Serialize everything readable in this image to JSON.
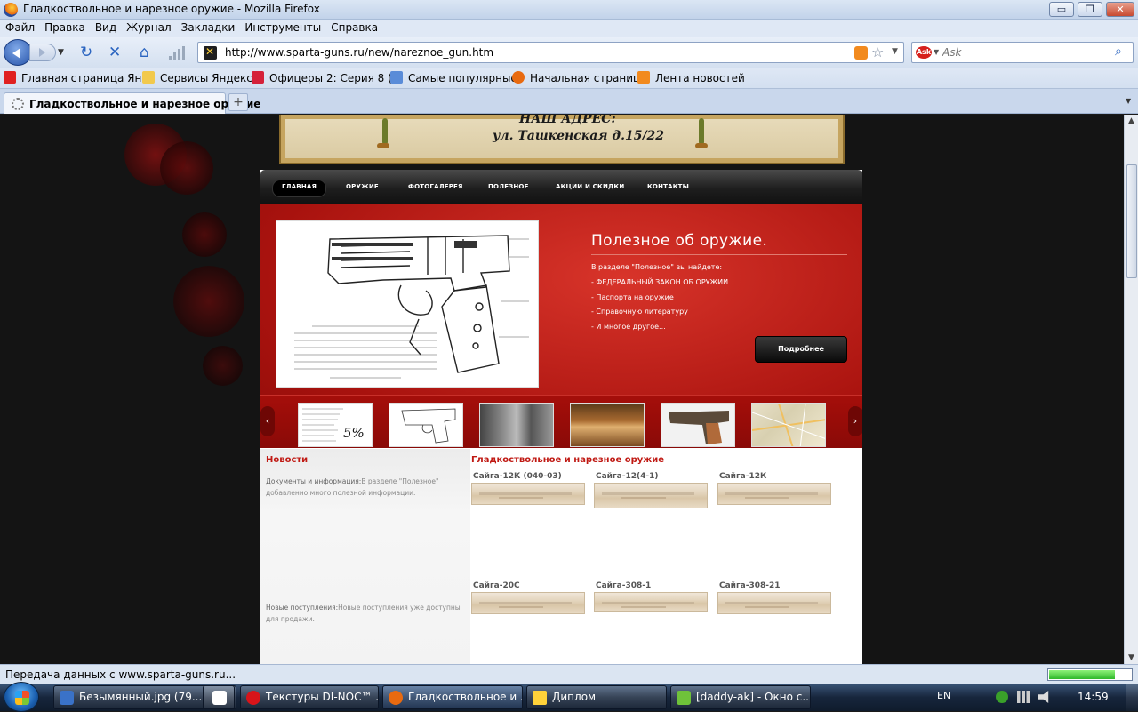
{
  "window": {
    "title": "Гладкоствольное и нарезное оружие - Mozilla Firefox",
    "buttons": {
      "minimize": "▭",
      "maximize": "❐",
      "close": "✕"
    }
  },
  "menu": [
    "Файл",
    "Правка",
    "Вид",
    "Журнал",
    "Закладки",
    "Инструменты",
    "Справка"
  ],
  "navigation": {
    "url": "http://www.sparta-guns.ru/new/nareznoe_gun.htm",
    "search_placeholder": "Ask",
    "search_engine_label": "Ask"
  },
  "bookmarks": [
    {
      "label": "Главная страница Ян...",
      "icon": "yandex-icon",
      "color": "#e02020"
    },
    {
      "label": "Сервисы Яндекса",
      "icon": "folder-icon",
      "color": "#f2c94c"
    },
    {
      "label": "Офицеры 2: Серия 8 (...",
      "icon": "ivi-icon",
      "color": "#d5213a"
    },
    {
      "label": "Самые популярные",
      "icon": "search-page-icon",
      "color": "#5a8cd8"
    },
    {
      "label": "Начальная страница",
      "icon": "firefox-icon",
      "color": "#e86a10"
    },
    {
      "label": "Лента новостей",
      "icon": "rss-icon",
      "color": "#f28a1e"
    }
  ],
  "tabs": [
    {
      "title": "Гладкоствольное и нарезное оружие",
      "active": true
    }
  ],
  "banner": {
    "heading": "НАШ АДРЕС:",
    "address": "ул. Ташкенская д.15/22"
  },
  "site_nav": [
    "ГЛАВНАЯ",
    "ОРУЖИЕ",
    "ФОТОГАЛЕРЕЯ",
    "ПОЛЕЗНОЕ",
    "АКЦИИ И СКИДКИ",
    "КОНТАКТЫ"
  ],
  "hero": {
    "title": "Полезное об оружие.",
    "intro": "В разделе \"Полезное\" вы найдете:",
    "items": [
      "- ФЕДЕРАЛЬНЫЙ ЗАКОН ОБ ОРУЖИИ",
      "- Паспорта на оружие",
      "- Справочную литературу",
      "- И многое другое..."
    ],
    "button": "Подробнее",
    "accent": "#b3150f"
  },
  "carousel": {
    "left_arrow": "‹",
    "right_arrow": "›",
    "first_thumb_badge": "5%"
  },
  "news": {
    "title": "Новости",
    "items": [
      {
        "label": "Документы и информация:",
        "text": "В разделе \"Полезное\" добавленно много полезной информации."
      },
      {
        "label": "Новые поступления:",
        "text": "Новые поступления уже доступны для продажи."
      }
    ]
  },
  "catalog": {
    "title": "Гладкоствольное и нарезное оружие",
    "products": [
      "Сайга-12К (040-03)",
      "Сайга-12(4-1)",
      "Сайга-12К",
      "Сайга-20С",
      "Сайга-308-1",
      "Сайга-308-21"
    ]
  },
  "status": {
    "text": "Передача данных с www.sparta-guns.ru...",
    "progress": 0.8
  },
  "taskbar": {
    "tasks": [
      {
        "label": "Безымянный.jpg (79...",
        "icon": "paint-icon",
        "color": "#3a72c8"
      },
      {
        "label": "",
        "icon": "app-icon",
        "color": "#ffffff"
      },
      {
        "label": "Текстуры DI-NOC™ ...",
        "icon": "opera-icon",
        "color": "#d8141a"
      },
      {
        "label": "Гладкоствольное и ...",
        "icon": "firefox-icon",
        "color": "#e86a10",
        "active": true
      },
      {
        "label": "Диплом",
        "icon": "warning-icon",
        "color": "#ffd23a"
      },
      {
        "label": "[daddy-ak] - Окно с...",
        "icon": "chat-icon",
        "color": "#6fc23a"
      }
    ],
    "language": "EN",
    "clock": "14:59"
  }
}
